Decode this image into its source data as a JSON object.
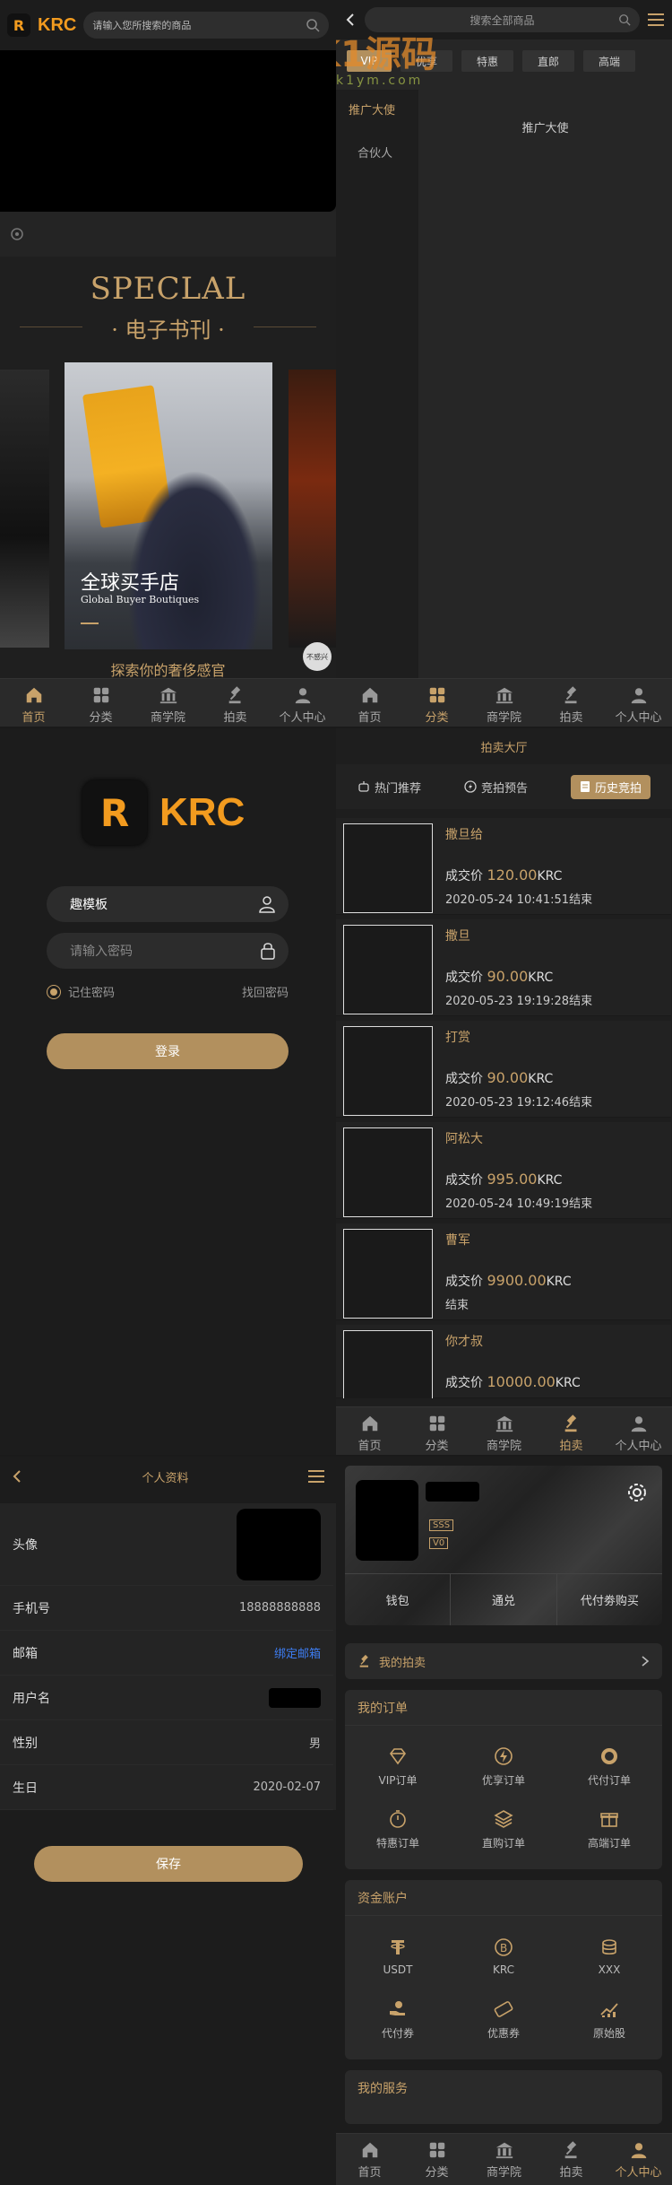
{
  "home": {
    "logo_text": "KRC",
    "search_placeholder": "请输入您所搜索的商品",
    "special_title": "SPECLAL",
    "special_subtitle": "· 电子书刊 ·",
    "banner_title": "全球买手店",
    "banner_subtitle": "Global Buyer Boutiques",
    "caption": "探索你的奢侈感官",
    "float_badge": "不感兴"
  },
  "category": {
    "search_placeholder": "搜索全部商品",
    "chips": [
      "VIP",
      "优享",
      "特惠",
      "直郎",
      "高端"
    ],
    "side_items": [
      "推广大使",
      "合伙人"
    ],
    "content_label": "推广大使",
    "watermark_text": "K1源码",
    "watermark_sub": "k1ym.com"
  },
  "tabs": [
    "首页",
    "分类",
    "商学院",
    "拍卖",
    "个人中心"
  ],
  "login": {
    "logo_text": "KRC",
    "username_value": "趣模板",
    "password_placeholder": "请输入密码",
    "remember_label": "记住密码",
    "forgot_label": "找回密码",
    "login_button": "登录"
  },
  "auction": {
    "header_title": "拍卖大厅",
    "tabs": [
      "热门推荐",
      "竞拍预告",
      "历史竞拍"
    ],
    "price_label": "成交价",
    "currency": "KRC",
    "items": [
      {
        "name": "撒旦给",
        "price": "120.00",
        "date": "2020-05-24 10:41:51结束"
      },
      {
        "name": "撒旦",
        "price": "90.00",
        "date": "2020-05-23 19:19:28结束"
      },
      {
        "name": "打赏",
        "price": "90.00",
        "date": "2020-05-23 19:12:46结束"
      },
      {
        "name": "阿松大",
        "price": "995.00",
        "date": "2020-05-24 10:49:19结束"
      },
      {
        "name": "曹军",
        "price": "9900.00",
        "date": "结束"
      },
      {
        "name": "你才叔",
        "price": "10000.00",
        "date": ""
      }
    ]
  },
  "profile": {
    "header_title": "个人资料",
    "rows": [
      {
        "label": "头像",
        "value": ""
      },
      {
        "label": "手机号",
        "value": "18888888888"
      },
      {
        "label": "邮箱",
        "value": "绑定邮箱"
      },
      {
        "label": "用户名",
        "value": ""
      },
      {
        "label": "性别",
        "value": "男"
      },
      {
        "label": "生日",
        "value": "2020-02-07"
      }
    ],
    "save_button": "保存"
  },
  "me": {
    "badge1": "SSS",
    "badge2": "V0",
    "wallet_items": [
      "钱包",
      "通兑",
      "代付劵购买"
    ],
    "my_auction": "我的拍卖",
    "orders_title": "我的订单",
    "orders": [
      "VIP订单",
      "优享订单",
      "代付订单",
      "特惠订单",
      "直购订单",
      "高端订单"
    ],
    "assets_title": "资金账户",
    "assets": [
      "USDT",
      "KRC",
      "XXX",
      "代付券",
      "优惠券",
      "原始股"
    ],
    "services_title": "我的服务"
  },
  "colors": {
    "accent": "#c8a26a",
    "bg": "#1a1a1a",
    "orange": "#f29b1f"
  }
}
